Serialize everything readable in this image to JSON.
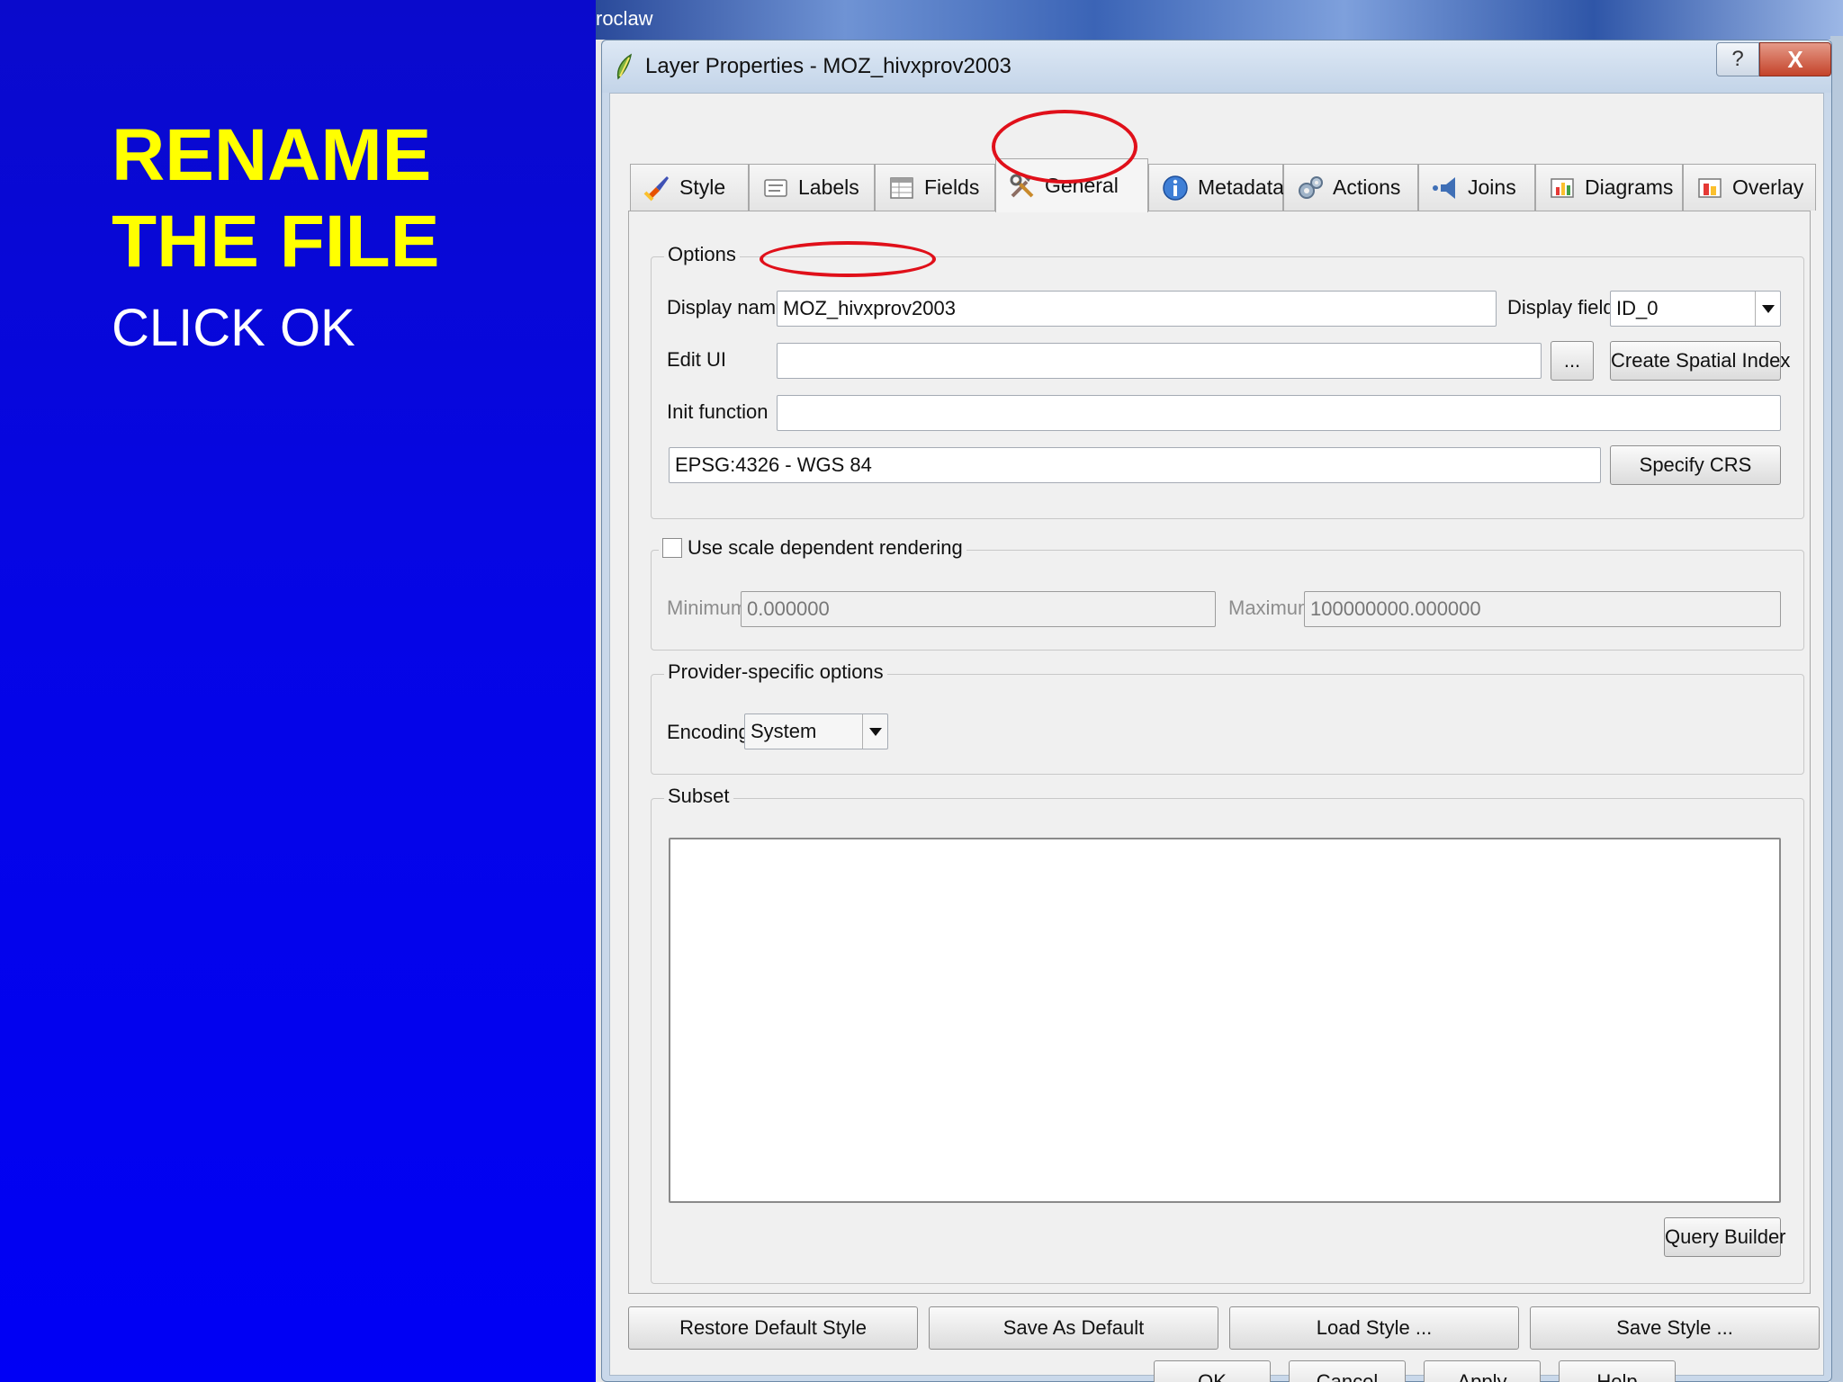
{
  "slide": {
    "title": "RENAME\nTHE FILE",
    "subtitle": "CLICK OK"
  },
  "background_app": {
    "title_fragment": "roclaw"
  },
  "dialog": {
    "title": "Layer Properties - MOZ_hivxprov2003",
    "help_label": "?",
    "close_label": "X"
  },
  "tabs": [
    {
      "label": "Style",
      "icon": "paintbrush-icon"
    },
    {
      "label": "Labels",
      "icon": "labels-icon"
    },
    {
      "label": "Fields",
      "icon": "table-icon"
    },
    {
      "label": "General",
      "icon": "tools-icon",
      "active": true
    },
    {
      "label": "Metadata",
      "icon": "info-icon"
    },
    {
      "label": "Actions",
      "icon": "gears-icon"
    },
    {
      "label": "Joins",
      "icon": "speaker-icon"
    },
    {
      "label": "Diagrams",
      "icon": "diagram-icon"
    },
    {
      "label": "Overlay",
      "icon": "overlay-icon"
    }
  ],
  "options": {
    "group_title": "Options",
    "display_name_label": "Display name",
    "display_name_value": "MOZ_hivxprov2003",
    "display_field_label": "Display field",
    "display_field_value": "ID_0",
    "edit_ui_label": "Edit UI",
    "edit_ui_value": "",
    "browse_label": "...",
    "create_spatial_index_label": "Create Spatial Index",
    "init_function_label": "Init function",
    "init_function_value": "",
    "crs_value": "EPSG:4326 - WGS 84",
    "specify_crs_label": "Specify CRS"
  },
  "scale": {
    "group_title": "Use scale dependent rendering",
    "checked": false,
    "minimum_label": "Minimum",
    "minimum_value": "0.000000",
    "maximum_label": "Maximum",
    "maximum_value": "100000000.000000"
  },
  "provider": {
    "group_title": "Provider-specific options",
    "encoding_label": "Encoding",
    "encoding_value": "System"
  },
  "subset": {
    "group_title": "Subset",
    "query_value": "",
    "query_builder_label": "Query Builder"
  },
  "style_buttons": {
    "restore_default": "Restore Default Style",
    "save_as_default": "Save As Default",
    "load_style": "Load Style ...",
    "save_style": "Save Style ..."
  },
  "dialog_buttons": {
    "ok": "OK",
    "cancel": "Cancel",
    "apply": "Apply",
    "help": "Help"
  },
  "colors": {
    "slide_title": "#ffff00",
    "slide_background": "#0000ee",
    "highlight_ellipse": "#e0101a"
  }
}
